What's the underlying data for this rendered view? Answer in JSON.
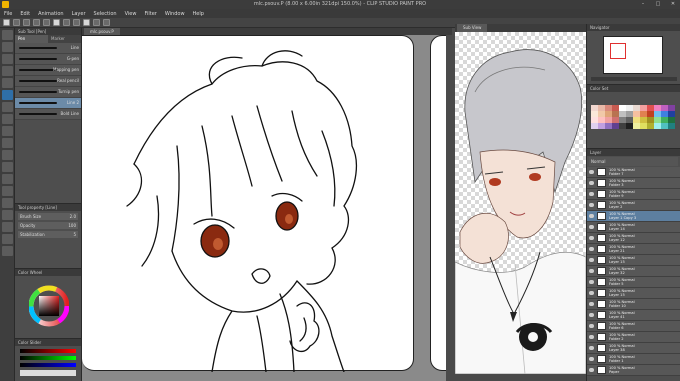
{
  "window": {
    "title": "mlc.psouv.P (8.00 x 6.00in 321dpi 150.0%) - CLIP STUDIO PAINT PRO"
  },
  "menu": [
    "File",
    "Edit",
    "Animation",
    "Layer",
    "Selection",
    "View",
    "Filter",
    "Window",
    "Help"
  ],
  "subtool": {
    "header": "Sub Tool [Pen]",
    "tabs": [
      "Pen",
      "Marker"
    ],
    "brushes": [
      "Line",
      "G-pen",
      "Mapping pen",
      "Real pencil",
      "Turnip pen",
      "Line 2",
      "Bold Line"
    ]
  },
  "toolprop": {
    "header": "Tool property [Line]",
    "rows": [
      {
        "label": "Brush Size",
        "value": "2.0"
      },
      {
        "label": "Opacity",
        "value": "100"
      },
      {
        "label": "Stabilization",
        "value": "5"
      }
    ]
  },
  "colorwheel": {
    "header": "Color Wheel"
  },
  "colorslider": {
    "header": "Color Slider"
  },
  "canvas1": {
    "tab": "mlc.psouv.P"
  },
  "canvas2": {
    "tab": "Sub View"
  },
  "navigator": {
    "header": "Navigator"
  },
  "colorset": {
    "header": "Color Set",
    "swatches": [
      "#f2d7cf",
      "#e9b9a8",
      "#d9897b",
      "#c75a50",
      "#ffffff",
      "#f0f0f0",
      "#e8d8d0",
      "#f4a0a0",
      "#e05050",
      "#f080c0",
      "#c060c0",
      "#8040a0",
      "#fbe8d9",
      "#f1c9a8",
      "#e0a578",
      "#b87350",
      "#c0c0c0",
      "#a0a0a0",
      "#f6c0a0",
      "#e08050",
      "#c04020",
      "#70c0f0",
      "#4080e0",
      "#2040a0",
      "#ffe0e0",
      "#ffc0c0",
      "#f0a0a0",
      "#d07070",
      "#808080",
      "#606060",
      "#f0e080",
      "#d0c040",
      "#a09020",
      "#90e090",
      "#40b060",
      "#207040",
      "#e0d0f0",
      "#c0a0e0",
      "#9070c0",
      "#604090",
      "#404040",
      "#202020",
      "#f0f0a0",
      "#e0e060",
      "#b0b030",
      "#a0f0f0",
      "#50c0c0",
      "#208080"
    ]
  },
  "layers": {
    "header": "Layer",
    "blend": "Normal",
    "items": [
      {
        "name": "100 % Normal",
        "sub": "Folder 7"
      },
      {
        "name": "100 % Normal",
        "sub": "Folder 3"
      },
      {
        "name": "100 % Normal",
        "sub": "Folder 9"
      },
      {
        "name": "100 % Normal",
        "sub": "Layer 2"
      },
      {
        "name": "100 % Normal",
        "sub": "Layer 1 Copy 3",
        "selected": true
      },
      {
        "name": "100 % Normal",
        "sub": "Layer 14"
      },
      {
        "name": "100 % Normal",
        "sub": "Layer 12"
      },
      {
        "name": "100 % Normal",
        "sub": "Layer 21"
      },
      {
        "name": "100 % Normal",
        "sub": "Layer 15"
      },
      {
        "name": "100 % Normal",
        "sub": "Layer 32"
      },
      {
        "name": "100 % Normal",
        "sub": "Folder 5"
      },
      {
        "name": "100 % Normal",
        "sub": "Layer 15"
      },
      {
        "name": "100 % Normal",
        "sub": "Folder 10"
      },
      {
        "name": "100 % Normal",
        "sub": "Layer 41"
      },
      {
        "name": "100 % Normal",
        "sub": "Folder 6"
      },
      {
        "name": "100 % Normal",
        "sub": "Folder 2"
      },
      {
        "name": "100 % Normal",
        "sub": "Layer 38"
      },
      {
        "name": "100 % Normal",
        "sub": "Folder 1"
      },
      {
        "name": "100 % Normal",
        "sub": "Paper"
      }
    ]
  }
}
